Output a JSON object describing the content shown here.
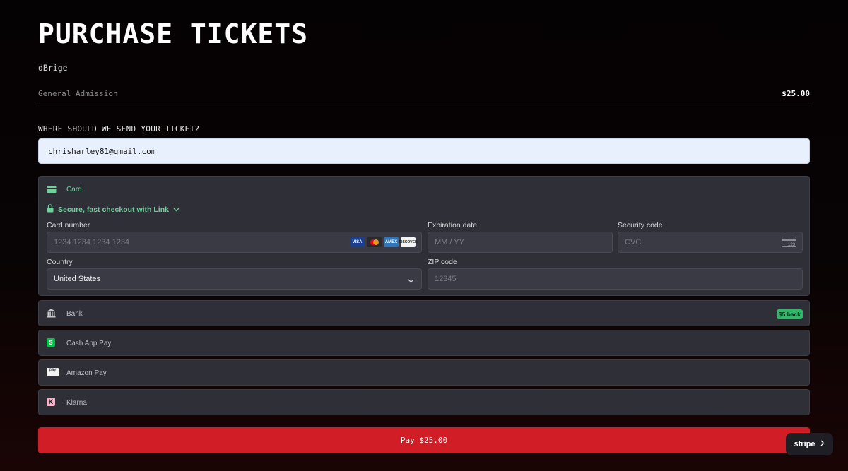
{
  "page": {
    "title": "PURCHASE TICKETS",
    "event_name": "dBrige"
  },
  "ticket": {
    "type": "General Admission",
    "price": "$25.00"
  },
  "email": {
    "label": "WHERE SHOULD WE SEND YOUR TICKET?",
    "value": "chrisharley81@gmail.com"
  },
  "payment": {
    "card": {
      "label": "Card",
      "link_text": "Secure, fast checkout with Link",
      "card_number_label": "Card number",
      "card_number_placeholder": "1234 1234 1234 1234",
      "brands": [
        "VISA",
        "mastercard",
        "AMEX",
        "DISCOVER"
      ],
      "expiry_label": "Expiration date",
      "expiry_placeholder": "MM / YY",
      "cvc_label": "Security code",
      "cvc_placeholder": "CVC",
      "cvc_icon_text": "123",
      "country_label": "Country",
      "country_value": "United States",
      "zip_label": "ZIP code",
      "zip_placeholder": "12345"
    },
    "bank": {
      "label": "Bank",
      "badge": "$5 back"
    },
    "cashapp": {
      "label": "Cash App Pay",
      "icon_text": "$"
    },
    "amazon": {
      "label": "Amazon Pay",
      "icon_text": "pay"
    },
    "klarna": {
      "label": "Klarna",
      "icon_text": "K"
    }
  },
  "pay_button": {
    "label": "Pay $25.00"
  },
  "stripe": {
    "label": "stripe"
  },
  "colors": {
    "accent_red": "#d01d26",
    "link_green": "#6fd19a",
    "panel_bg": "#2f2f38"
  }
}
